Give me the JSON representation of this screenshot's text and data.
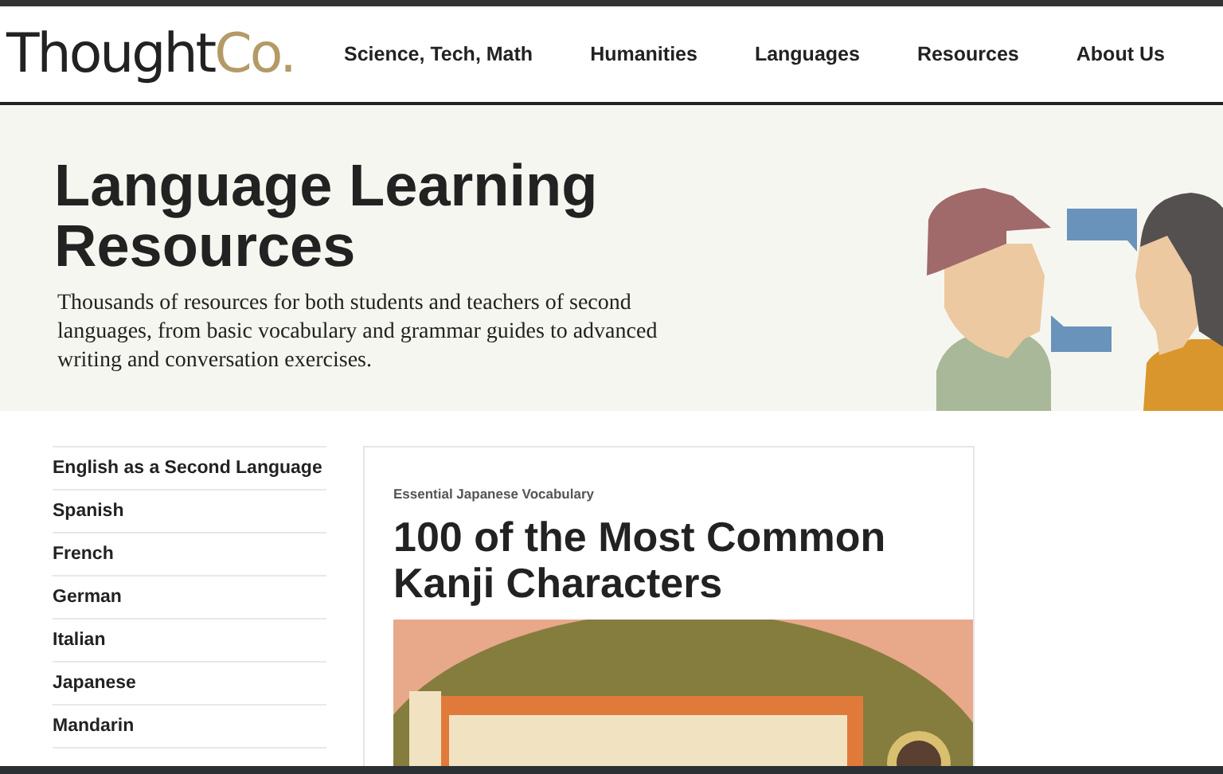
{
  "header": {
    "logo": {
      "main": "Thought",
      "accent": "Co."
    },
    "nav": [
      {
        "label": "Science, Tech, Math"
      },
      {
        "label": "Humanities"
      },
      {
        "label": "Languages"
      },
      {
        "label": "Resources"
      },
      {
        "label": "About Us"
      }
    ]
  },
  "hero": {
    "title": "Language Learning Resources",
    "description": "Thousands of resources for both students and teachers of second languages, from basic vocabulary and grammar guides to advanced writing and conversation exercises."
  },
  "sidebar": {
    "items": [
      {
        "label": "English as a Second Language"
      },
      {
        "label": "Spanish"
      },
      {
        "label": "French"
      },
      {
        "label": "German"
      },
      {
        "label": "Italian"
      },
      {
        "label": "Japanese"
      },
      {
        "label": "Mandarin"
      }
    ]
  },
  "article": {
    "category": "Essential Japanese Vocabulary",
    "title": "100 of the Most Common Kanji Characters"
  }
}
